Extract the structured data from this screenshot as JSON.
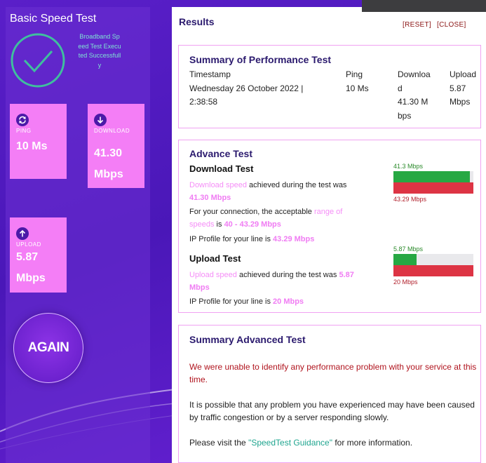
{
  "app": {
    "title": "Basic Speed Test",
    "status": "Broadband Speed Test Executed Successfully"
  },
  "tiles": {
    "ping": {
      "label": "PING",
      "value": "10 Ms",
      "icon": "refresh-icon"
    },
    "download": {
      "label": "DOWNLOAD",
      "value": "41.30 Mbps",
      "icon": "arrow-down-icon"
    },
    "upload": {
      "label": "UPLOAD",
      "value": "5.87 Mbps",
      "icon": "arrow-up-icon"
    }
  },
  "again_label": "AGAIN",
  "results": {
    "title": "Results",
    "reset_label": "[RESET]",
    "close_label": "[CLOSE]"
  },
  "summary": {
    "title": "Summary of Performance Test",
    "headers": {
      "timestamp": "Timestamp",
      "ping": "Ping",
      "download": "Download",
      "upload": "Upload"
    },
    "values": {
      "timestamp": "Wednesday 26 October 2022 | 2:38:58",
      "ping": "10 Ms",
      "download": "41.30 Mbps",
      "upload": "5.87 Mbps"
    }
  },
  "advance": {
    "title": "Advance Test",
    "download": {
      "title": "Download Test",
      "p1_link": "Download speed",
      "p1_text": "achieved during the test was",
      "p1_value": "41.30 Mbps",
      "p2_text": "For your connection, the acceptable",
      "p2_link": "range of speeds",
      "p2_is": "is",
      "p2_value": "40 - 43.29 Mbps",
      "p3_text": "IP Profile for your line is",
      "p3_value": "43.29 Mbps",
      "bar_top_label": "41.3 Mbps",
      "bar_bottom_label": "43.29 Mbps",
      "fill_fraction": 0.954
    },
    "upload": {
      "title": "Upload Test",
      "p1_link": "Upload speed",
      "p1_text": "achieved during the test was",
      "p1_value": "5.87 Mbps",
      "p3_text": "IP Profile for your line is",
      "p3_value": "20 Mbps",
      "bar_top_label": "5.87 Mbps",
      "bar_bottom_label": "20 Mbps",
      "fill_fraction": 0.2935
    }
  },
  "adv_summary": {
    "title": "Summary Advanced Test",
    "p1": "We were unable to identify any performance problem with your service at this time.",
    "p2": "It is possible that any problem you have experienced may have been caused by traffic congestion or by a server responding slowly.",
    "p3_prefix": "Please visit the",
    "p3_link": "\"SpeedTest Guidance\"",
    "p3_suffix": "for more information."
  },
  "colors": {
    "background": "#5a1fc9",
    "tile": "#f47ef6",
    "accent_pink": "#f07cf3",
    "bar_green": "#27a843",
    "bar_red": "#dd3444",
    "title_navy": "#2b1a6e",
    "check_teal": "#3fbf9e"
  }
}
